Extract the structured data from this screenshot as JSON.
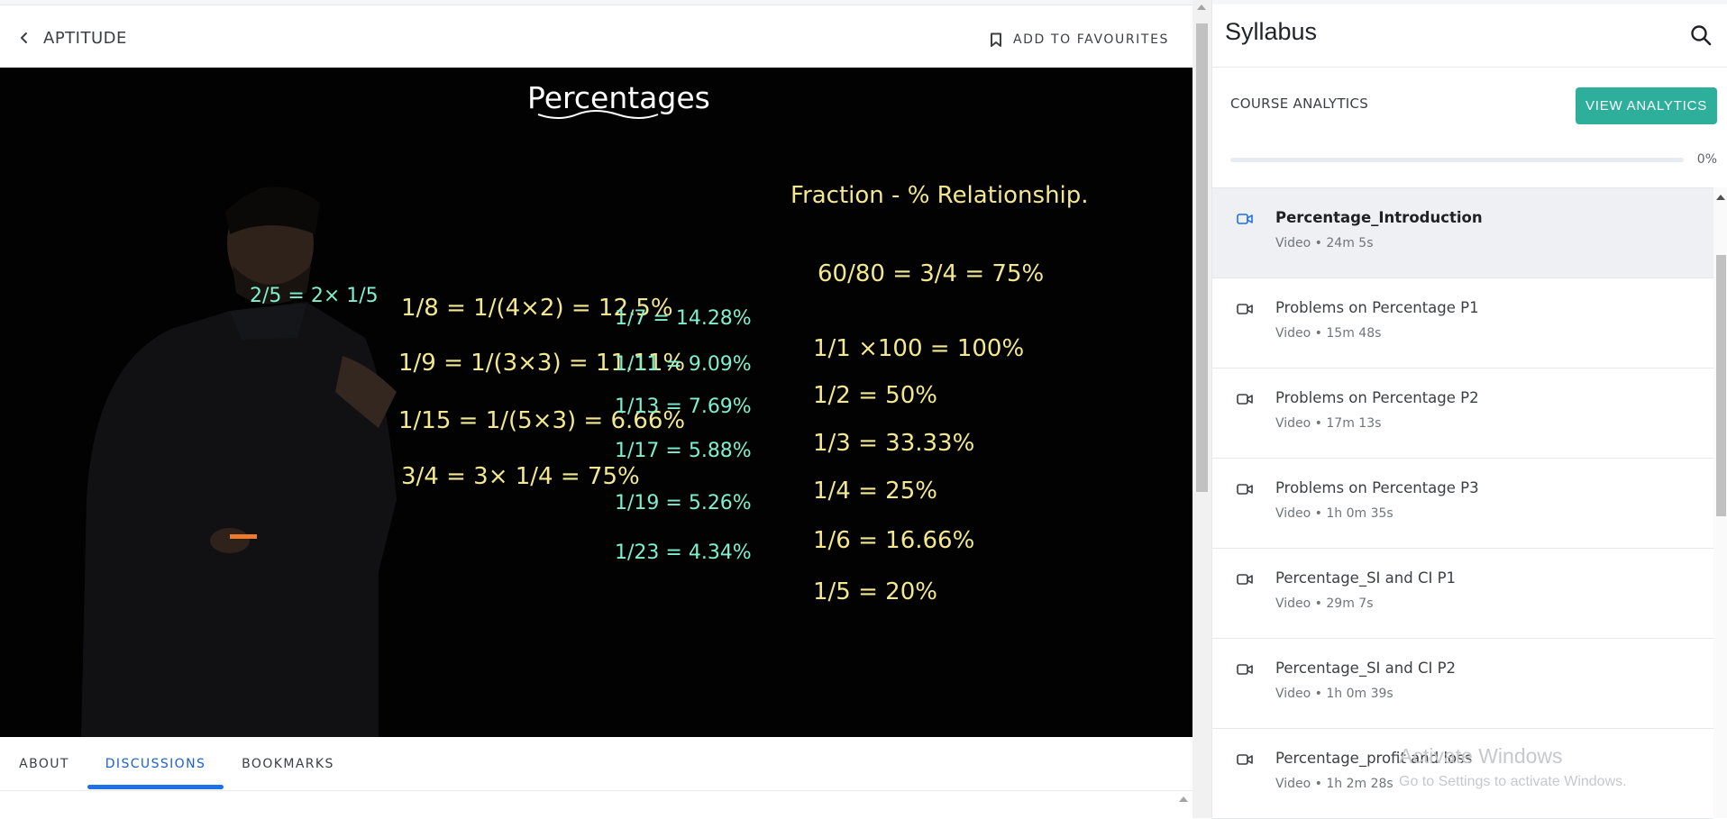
{
  "header": {
    "back_label": "APTITUDE",
    "favourites_label": "ADD TO FAVOURITES"
  },
  "video": {
    "board_title": "Percentages",
    "board_heading": "Fraction - % Relationship.",
    "board_lines": [
      "2/5 = 2× 1/5",
      "1/8 = 1/(4×2) = 12.5%",
      "1/9 = 1/(3×3) = 11.11%",
      "1/15 = 1/(5×3) = 6.66%",
      "3/4 = 3× 1/4 = 75%",
      "1/7 = 14.28%",
      "1/11 = 9.09%",
      "1/13 = 7.69%",
      "1/17 = 5.88%",
      "1/19 = 5.26%",
      "1/23 = 4.34%",
      "60/80 = 3/4 = 75%",
      "1/1 ×100 = 100%",
      "1/2 = 50%",
      "1/3 = 33.33%",
      "1/4 = 25%",
      "1/6 = 16.66%",
      "1/5 = 20%"
    ]
  },
  "tabs": {
    "about": "ABOUT",
    "discussions": "DISCUSSIONS",
    "bookmarks": "BOOKMARKS",
    "active": "DISCUSSIONS"
  },
  "syllabus": {
    "title": "Syllabus",
    "analytics_label": "COURSE ANALYTICS",
    "analytics_button": "VIEW ANALYTICS",
    "progress_percent": 0,
    "progress_text": "0%",
    "lessons": [
      {
        "title": "Percentage_Introduction",
        "meta": "Video • 24m 5s",
        "active": true
      },
      {
        "title": "Problems on Percentage P1",
        "meta": "Video • 15m 48s"
      },
      {
        "title": "Problems on Percentage P2",
        "meta": "Video • 17m 13s"
      },
      {
        "title": "Problems on Percentage P3",
        "meta": "Video • 1h 0m 35s"
      },
      {
        "title": "Percentage_SI and CI P1",
        "meta": "Video • 29m 7s"
      },
      {
        "title": "Percentage_SI and CI P2",
        "meta": "Video • 1h 0m 39s"
      },
      {
        "title": "Percentage_profit and loss",
        "meta": "Video • 1h 2m 28s"
      }
    ]
  },
  "watermark": {
    "line1": "Activate Windows",
    "line2": "Go to Settings to activate Windows."
  },
  "colors": {
    "accent_teal": "#2eaf9b",
    "tab_blue": "#1f6fe6",
    "active_row": "#eef0f4",
    "chalk_yellow": "#f3e88e",
    "chalk_cyan": "#7ef0d0"
  },
  "icons": {
    "back": "chevron-left-icon",
    "favourite": "bookmark-icon",
    "search": "search-icon",
    "lesson": "video-camera-icon"
  }
}
